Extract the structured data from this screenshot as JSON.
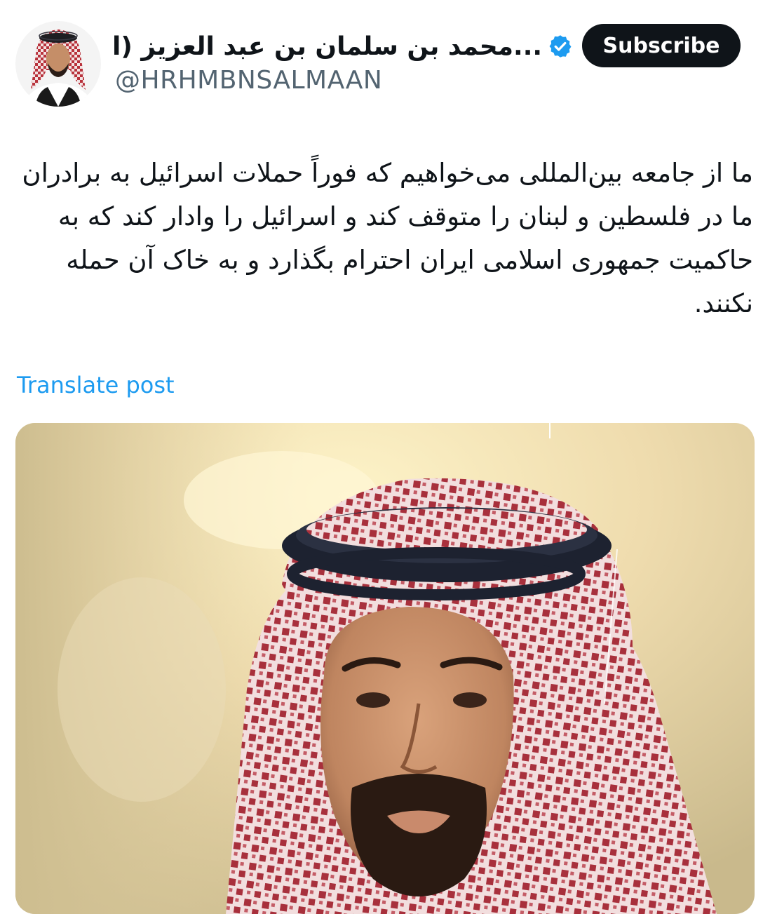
{
  "author": {
    "display_name": "محمد بن سلمان بن عبد العزيز (ا...",
    "handle": "@HRHMBNSALMAAN",
    "verified": true,
    "avatar_icon": "profile-photo"
  },
  "actions": {
    "subscribe_label": "Subscribe"
  },
  "tweet": {
    "text": "ما از جامعه بین‌المللی می‌خواهیم که فوراً حملات اسرائیل به برادران ما در فلسطین و لبنان را متوقف کند و اسرائیل را وادار کند که به حاکمیت جمهوری اسلامی ایران احترام بگذارد و به خاک آن حمله نکنند.",
    "translate_label": "Translate post"
  },
  "media": {
    "icon": "portrait-photo"
  },
  "colors": {
    "text_primary": "#0f1419",
    "text_secondary": "#536471",
    "link": "#1d9bf0",
    "verified": "#1d9bf0",
    "button_bg": "#0f1419",
    "button_text": "#ffffff"
  }
}
